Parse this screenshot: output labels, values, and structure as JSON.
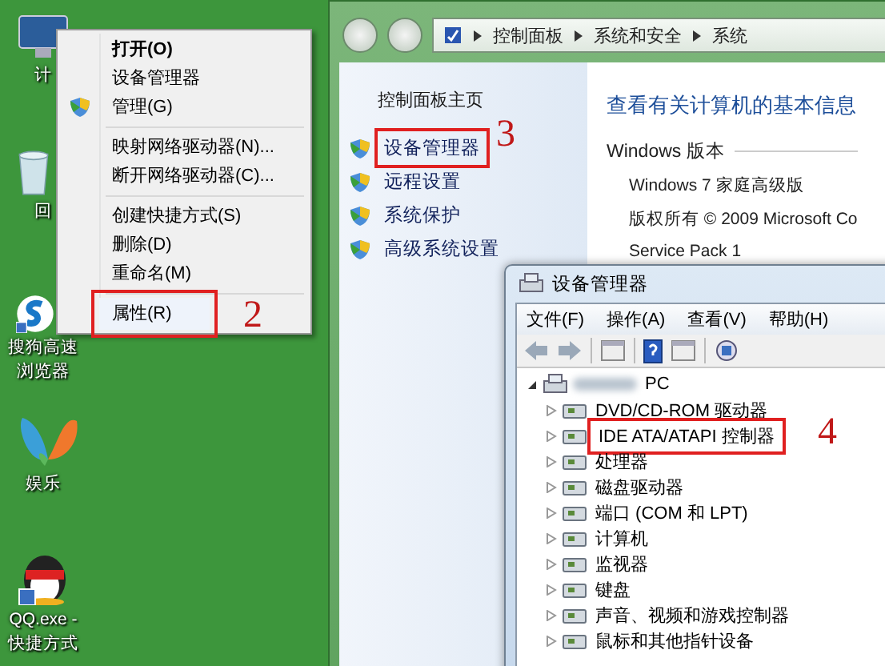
{
  "desktop": {
    "icons": [
      {
        "kind": "computer",
        "label": "计"
      },
      {
        "kind": "recycle",
        "label": "回"
      },
      {
        "kind": "browser",
        "label": "搜狗高速浏览器"
      },
      {
        "kind": "butterfly",
        "label": "娱乐"
      },
      {
        "kind": "penguin",
        "label": "QQ.exe - 快捷方式"
      }
    ]
  },
  "context_menu": {
    "items": [
      {
        "kind": "item",
        "label": "打开(O)",
        "default": true,
        "shield": false,
        "highlighted": false
      },
      {
        "kind": "item",
        "label": "设备管理器",
        "default": false,
        "shield": false,
        "highlighted": false
      },
      {
        "kind": "item",
        "label": "管理(G)",
        "default": false,
        "shield": true,
        "highlighted": false
      },
      {
        "kind": "separator"
      },
      {
        "kind": "item",
        "label": "映射网络驱动器(N)...",
        "default": false,
        "shield": false,
        "highlighted": false
      },
      {
        "kind": "item",
        "label": "断开网络驱动器(C)...",
        "default": false,
        "shield": false,
        "highlighted": false
      },
      {
        "kind": "separator"
      },
      {
        "kind": "item",
        "label": "创建快捷方式(S)",
        "default": false,
        "shield": false,
        "highlighted": false
      },
      {
        "kind": "item",
        "label": "删除(D)",
        "default": false,
        "shield": false,
        "highlighted": false
      },
      {
        "kind": "item",
        "label": "重命名(M)",
        "default": false,
        "shield": false,
        "highlighted": false
      },
      {
        "kind": "separator"
      },
      {
        "kind": "item",
        "label": "属性(R)",
        "default": false,
        "shield": false,
        "highlighted": true,
        "callout": "2"
      }
    ]
  },
  "system_window": {
    "breadcrumb": [
      "控制面板",
      "系统和安全",
      "系统"
    ],
    "sidebar": {
      "home": "控制面板主页",
      "links": [
        {
          "label": "设备管理器",
          "highlighted": true,
          "callout": "3"
        },
        {
          "label": "远程设置",
          "highlighted": false
        },
        {
          "label": "系统保护",
          "highlighted": false
        },
        {
          "label": "高级系统设置",
          "highlighted": false
        }
      ]
    },
    "heading": "查看有关计算机的基本信息",
    "section": "Windows 版本",
    "lines": [
      "Windows 7 家庭高级版",
      "版权所有 © 2009 Microsoft Co",
      "Service Pack 1"
    ]
  },
  "device_manager": {
    "title": "设备管理器",
    "menu": [
      "文件(F)",
      "操作(A)",
      "查看(V)",
      "帮助(H)"
    ],
    "tree": {
      "label": "PC",
      "expanded": true,
      "children": [
        {
          "label": "DVD/CD-ROM 驱动器",
          "expanded": false,
          "highlighted": false
        },
        {
          "label": "IDE ATA/ATAPI 控制器",
          "expanded": false,
          "highlighted": true,
          "callout": "4"
        },
        {
          "label": "处理器",
          "expanded": false,
          "highlighted": false
        },
        {
          "label": "磁盘驱动器",
          "expanded": false,
          "highlighted": false
        },
        {
          "label": "端口 (COM 和 LPT)",
          "expanded": false,
          "highlighted": false
        },
        {
          "label": "计算机",
          "expanded": false,
          "highlighted": false
        },
        {
          "label": "监视器",
          "expanded": false,
          "highlighted": false
        },
        {
          "label": "键盘",
          "expanded": false,
          "highlighted": false
        },
        {
          "label": "声音、视频和游戏控制器",
          "expanded": false,
          "highlighted": false
        },
        {
          "label": "鼠标和其他指针设备",
          "expanded": false,
          "highlighted": false
        }
      ]
    }
  }
}
